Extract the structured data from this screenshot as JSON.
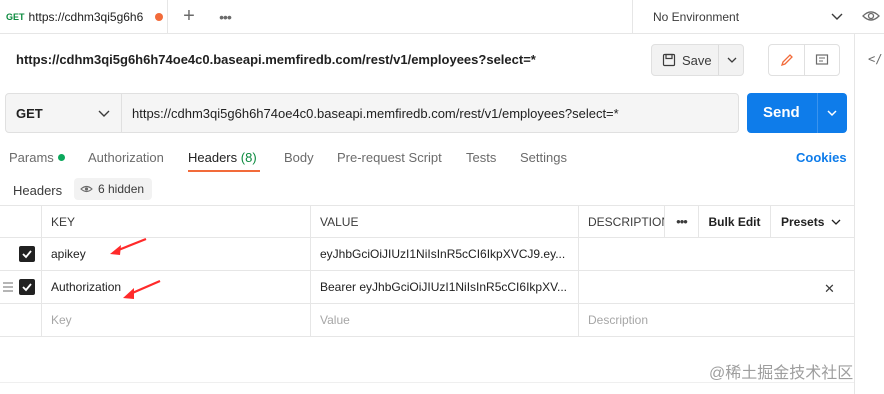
{
  "tab": {
    "method": "GET",
    "title": "https://cdhm3qi5g6h6"
  },
  "environment": {
    "label": "No Environment"
  },
  "request": {
    "title_url": "https://cdhm3qi5g6h6h74oe4c0.baseapi.memfiredb.com/rest/v1/employees?select=*",
    "method": "GET",
    "url": "https://cdhm3qi5g6h6h74oe4c0.baseapi.memfiredb.com/rest/v1/employees?select=*"
  },
  "toolbar": {
    "save_label": "Save",
    "send_label": "Send",
    "code_label": "</"
  },
  "subtabs": [
    {
      "label": "Params"
    },
    {
      "label": "Authorization"
    },
    {
      "label": "Headers",
      "count": "(8)"
    },
    {
      "label": "Body"
    },
    {
      "label": "Pre-request Script"
    },
    {
      "label": "Tests"
    },
    {
      "label": "Settings"
    }
  ],
  "cookies_label": "Cookies",
  "headers_section": {
    "title": "Headers",
    "hidden_label": "6 hidden"
  },
  "table": {
    "columns": {
      "key": "KEY",
      "value": "VALUE",
      "description": "DESCRIPTION",
      "bulk_edit": "Bulk Edit",
      "presets": "Presets"
    },
    "rows": [
      {
        "checked": true,
        "key": "apikey",
        "value": "eyJhbGciOiJIUzI1NiIsInR5cCI6IkpXVCJ9.ey..."
      },
      {
        "checked": true,
        "key": "Authorization",
        "value": "Bearer eyJhbGciOiJIUzI1NiIsInR5cCI6IkpXV..."
      }
    ],
    "placeholders": {
      "key": "Key",
      "value": "Value",
      "description": "Description"
    }
  },
  "watermark": "@稀土掘金技术社区",
  "colors": {
    "accent": "#f26b3a",
    "send": "#0e7cea",
    "annotation_arrow": "#ff2a2a",
    "params_dot": "#0ca85c"
  }
}
